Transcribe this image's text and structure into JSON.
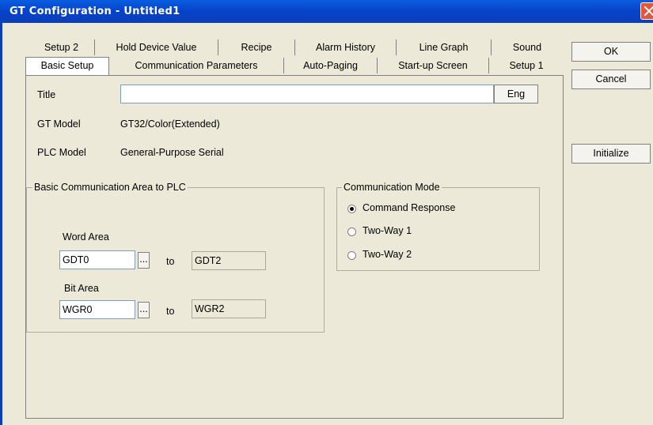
{
  "window": {
    "title": "GT Configuration - Untitled1"
  },
  "tabs_back": [
    "Setup 2",
    "Hold Device Value",
    "Recipe",
    "Alarm History",
    "Line Graph",
    "Sound"
  ],
  "tabs_front": [
    "Basic Setup",
    "Communication Parameters",
    "Auto-Paging",
    "Start-up Screen",
    "Setup 1"
  ],
  "form": {
    "title_label": "Title",
    "title_value": "",
    "eng_label": "Eng",
    "gt_model_label": "GT Model",
    "gt_model_value": "GT32/Color(Extended)",
    "plc_model_label": "PLC Model",
    "plc_model_value": "General-Purpose Serial"
  },
  "comm_area": {
    "legend": "Basic Communication Area to PLC",
    "word_label": "Word Area",
    "word_from": "GDT0",
    "word_to": "GDT2",
    "bit_label": "Bit Area",
    "bit_from": "WGR0",
    "bit_to": "WGR2",
    "to_label": "to",
    "browse_label": "..."
  },
  "comm_mode": {
    "legend": "Communication Mode",
    "options": [
      "Command Response",
      "Two-Way 1",
      "Two-Way 2"
    ],
    "selected": "Command Response"
  },
  "buttons": {
    "ok": "OK",
    "cancel": "Cancel",
    "initialize": "Initialize"
  }
}
